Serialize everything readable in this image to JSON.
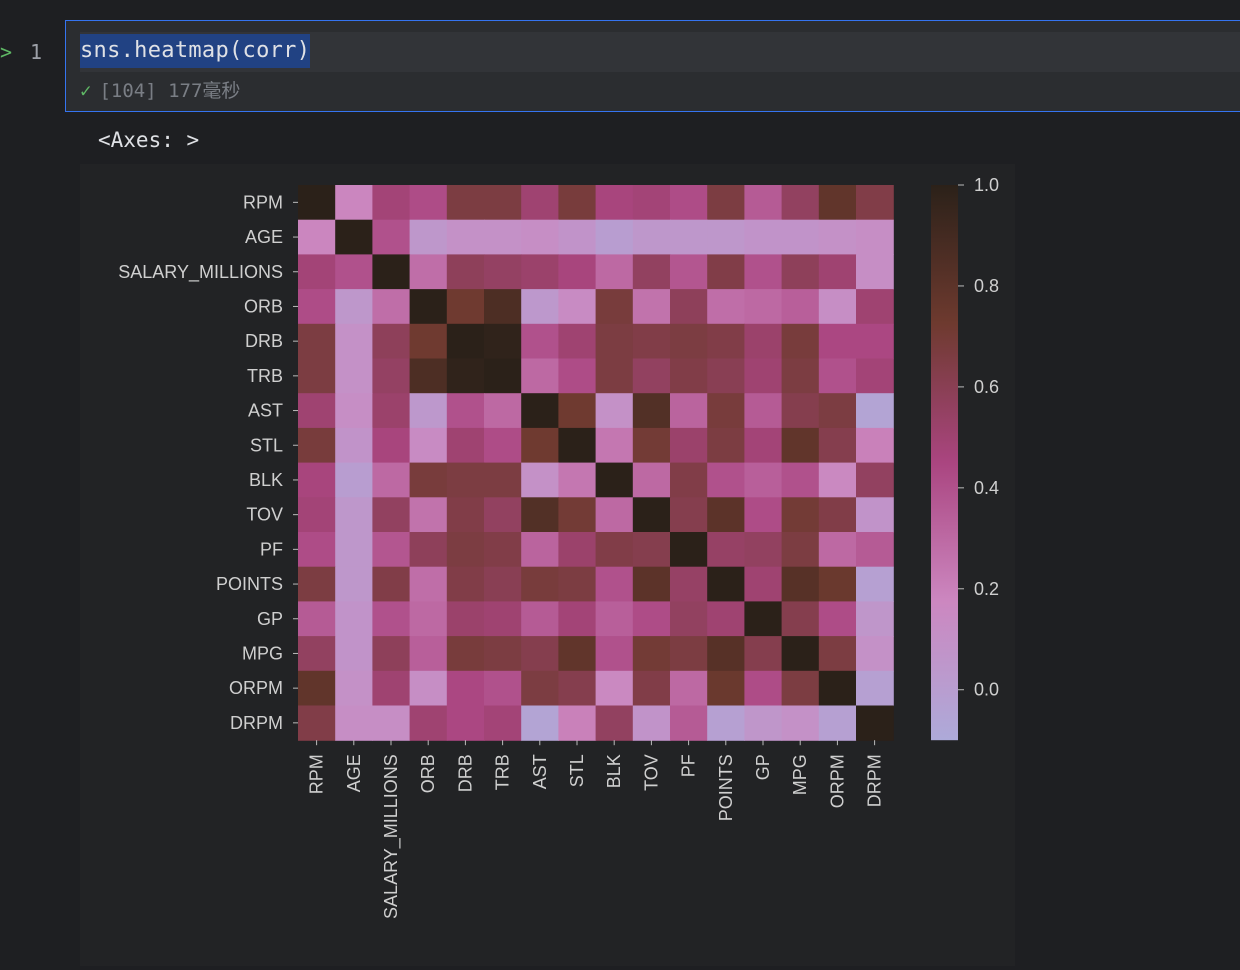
{
  "gutter": {
    "run_marker": ">",
    "line_number": "1"
  },
  "cell": {
    "code": "sns.heatmap(corr)",
    "exec_label": "[104] 177毫秒"
  },
  "output": {
    "repr": "<Axes: >"
  },
  "chart_data": {
    "type": "heatmap",
    "labels": [
      "RPM",
      "AGE",
      "SALARY_MILLIONS",
      "ORB",
      "DRB",
      "TRB",
      "AST",
      "STL",
      "BLK",
      "TOV",
      "PF",
      "POINTS",
      "GP",
      "MPG",
      "ORPM",
      "DRPM"
    ],
    "colorbar": {
      "ticks": [
        "1.0",
        "0.8",
        "0.6",
        "0.4",
        "0.2",
        "0.0"
      ],
      "range": [
        -0.1,
        1.0
      ]
    },
    "colors": [
      "#adaad9",
      "#cc87c0",
      "#aa4580",
      "#6e3a2f",
      "#2b2119"
    ],
    "matrix": [
      [
        1.0,
        0.18,
        0.48,
        0.42,
        0.66,
        0.66,
        0.5,
        0.68,
        0.46,
        0.48,
        0.42,
        0.66,
        0.36,
        0.56,
        0.78,
        0.64
      ],
      [
        0.18,
        1.0,
        0.4,
        0.05,
        0.1,
        0.1,
        0.12,
        0.08,
        0.0,
        0.05,
        0.05,
        0.05,
        0.08,
        0.08,
        0.1,
        0.12
      ],
      [
        0.48,
        0.4,
        1.0,
        0.28,
        0.58,
        0.55,
        0.52,
        0.46,
        0.3,
        0.56,
        0.38,
        0.64,
        0.4,
        0.58,
        0.5,
        0.12
      ],
      [
        0.42,
        0.05,
        0.28,
        1.0,
        0.72,
        0.86,
        0.04,
        0.14,
        0.68,
        0.26,
        0.58,
        0.28,
        0.3,
        0.34,
        0.12,
        0.5
      ],
      [
        0.66,
        0.1,
        0.58,
        0.72,
        1.0,
        0.98,
        0.4,
        0.5,
        0.66,
        0.64,
        0.66,
        0.64,
        0.52,
        0.68,
        0.44,
        0.44
      ],
      [
        0.66,
        0.1,
        0.55,
        0.86,
        0.98,
        1.0,
        0.3,
        0.42,
        0.66,
        0.56,
        0.64,
        0.6,
        0.5,
        0.66,
        0.4,
        0.48
      ],
      [
        0.5,
        0.12,
        0.52,
        0.04,
        0.4,
        0.3,
        1.0,
        0.72,
        0.1,
        0.84,
        0.32,
        0.68,
        0.36,
        0.62,
        0.66,
        -0.05
      ],
      [
        0.68,
        0.08,
        0.46,
        0.14,
        0.5,
        0.42,
        0.72,
        1.0,
        0.24,
        0.7,
        0.52,
        0.66,
        0.48,
        0.78,
        0.62,
        0.2
      ],
      [
        0.46,
        0.0,
        0.3,
        0.68,
        0.66,
        0.66,
        0.1,
        0.24,
        1.0,
        0.3,
        0.64,
        0.4,
        0.34,
        0.4,
        0.16,
        0.56
      ],
      [
        0.48,
        0.05,
        0.56,
        0.26,
        0.64,
        0.56,
        0.84,
        0.7,
        0.3,
        1.0,
        0.62,
        0.8,
        0.42,
        0.7,
        0.64,
        0.08
      ],
      [
        0.42,
        0.05,
        0.38,
        0.58,
        0.66,
        0.64,
        0.32,
        0.52,
        0.64,
        0.62,
        1.0,
        0.54,
        0.56,
        0.66,
        0.3,
        0.36
      ],
      [
        0.66,
        0.05,
        0.64,
        0.28,
        0.64,
        0.6,
        0.68,
        0.66,
        0.4,
        0.8,
        0.54,
        1.0,
        0.5,
        0.82,
        0.74,
        -0.02
      ],
      [
        0.36,
        0.08,
        0.4,
        0.3,
        0.52,
        0.5,
        0.36,
        0.48,
        0.34,
        0.42,
        0.56,
        0.5,
        1.0,
        0.62,
        0.42,
        0.06
      ],
      [
        0.56,
        0.08,
        0.58,
        0.34,
        0.68,
        0.66,
        0.62,
        0.78,
        0.4,
        0.7,
        0.66,
        0.82,
        0.62,
        1.0,
        0.66,
        0.1
      ],
      [
        0.78,
        0.1,
        0.5,
        0.12,
        0.44,
        0.4,
        0.66,
        0.62,
        0.16,
        0.64,
        0.3,
        0.74,
        0.42,
        0.66,
        1.0,
        -0.02
      ],
      [
        0.64,
        0.12,
        0.12,
        0.5,
        0.44,
        0.48,
        -0.05,
        0.2,
        0.56,
        0.08,
        0.36,
        -0.02,
        0.06,
        0.1,
        -0.02,
        1.0
      ]
    ]
  }
}
